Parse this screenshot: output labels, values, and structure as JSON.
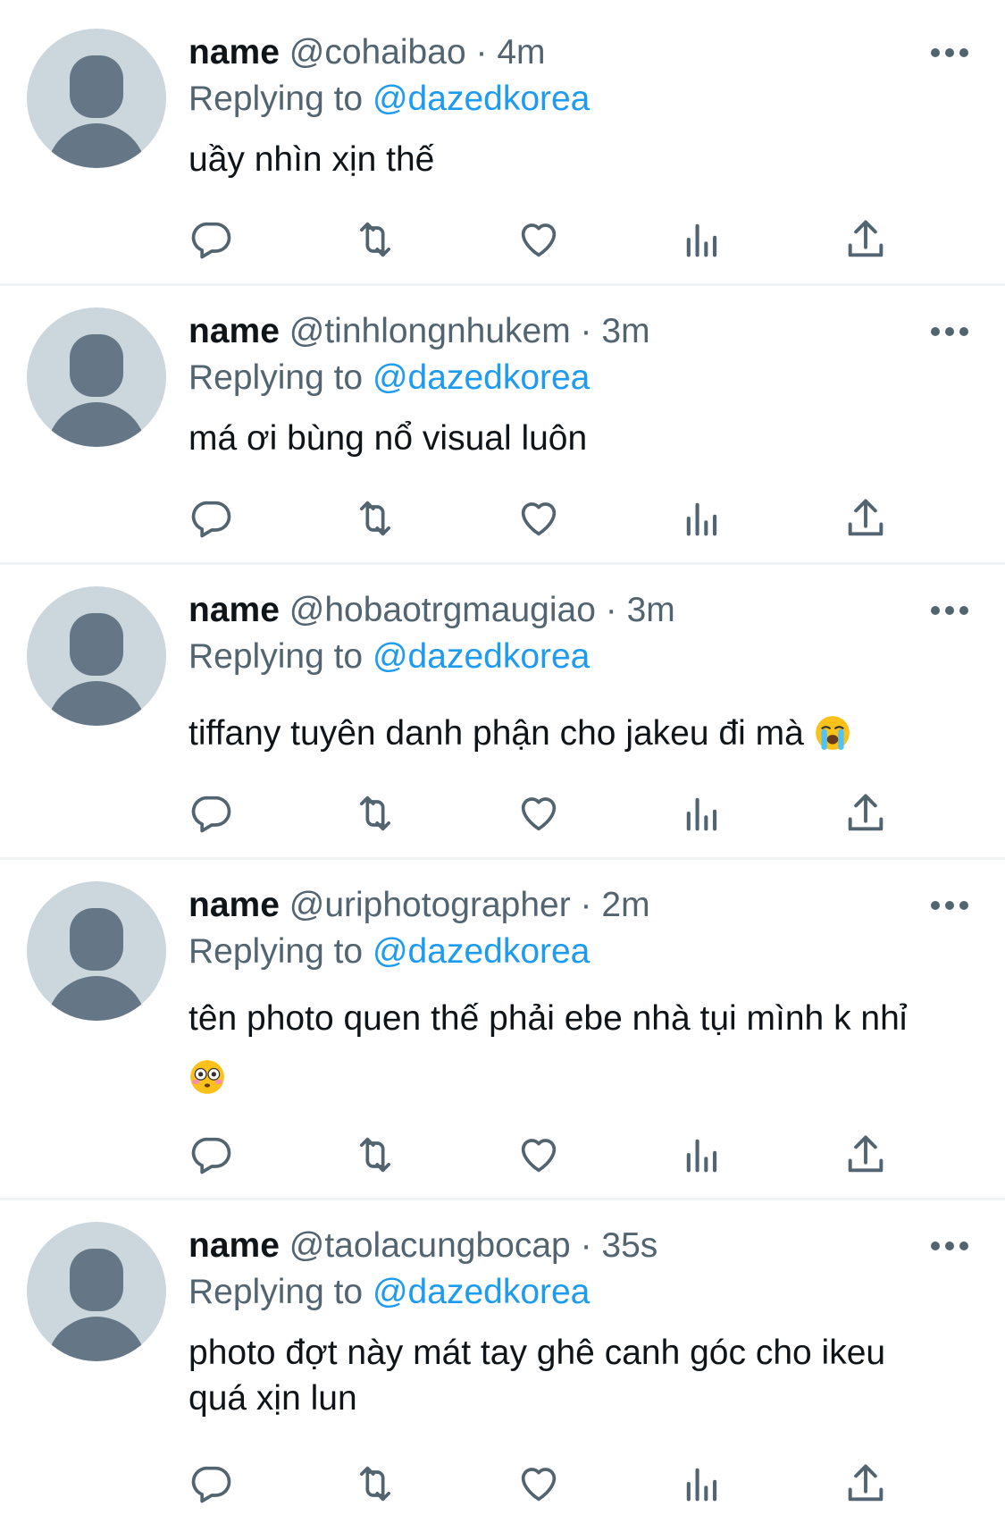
{
  "tweets": [
    {
      "name": "name",
      "handle": "@cohaibao",
      "dot": "·",
      "time": "4m",
      "replying_prefix": "Replying to",
      "replying_to": "@dazedkorea",
      "text": "uầy nhìn xịn thế",
      "emoji": ""
    },
    {
      "name": "name",
      "handle": "@tinhlongnhukem",
      "dot": "·",
      "time": "3m",
      "replying_prefix": "Replying to",
      "replying_to": "@dazedkorea",
      "text": "má ơi bùng nổ visual luôn",
      "emoji": ""
    },
    {
      "name": "name",
      "handle": "@hobaotrgmaugiao",
      "dot": "·",
      "time": "3m",
      "replying_prefix": "Replying to",
      "replying_to": "@dazedkorea",
      "text": "tiffany tuyên danh phận cho jakeu đi mà",
      "emoji": "loudly-crying-face"
    },
    {
      "name": "name",
      "handle": "@uriphotographer",
      "dot": "·",
      "time": "2m",
      "replying_prefix": "Replying to",
      "replying_to": "@dazedkorea",
      "text": "tên photo quen thế phải ebe nhà tụi mình k nhỉ",
      "emoji": "flushed-face"
    },
    {
      "name": "name",
      "handle": "@taolacungbocap",
      "dot": "·",
      "time": "35s",
      "replying_prefix": "Replying to",
      "replying_to": "@dazedkorea",
      "text": "photo đợt này mát tay ghê canh góc cho ikeu quá xịn lun",
      "emoji": ""
    }
  ],
  "icons": {
    "reply": "reply-icon",
    "retweet": "retweet-icon",
    "like": "like-icon",
    "views": "views-icon",
    "share": "share-icon",
    "more": "more-icon"
  },
  "colors": {
    "link": "#1d9bf0",
    "secondary_text": "#536471",
    "avatar_bg": "#ccd6dd",
    "avatar_fg": "#657786",
    "divider": "#eff3f4"
  }
}
